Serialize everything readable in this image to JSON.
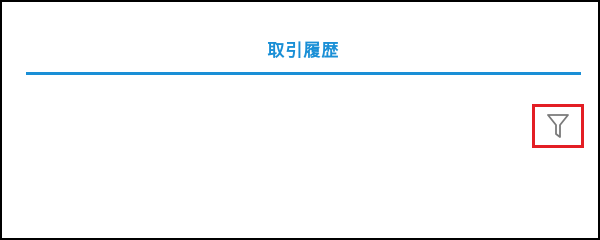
{
  "tab": {
    "active_label": "取引履歴"
  },
  "filter": {
    "icon": "filter-icon"
  },
  "colors": {
    "accent": "#1a8fd6",
    "highlight": "#e31e24",
    "icon": "#7a7a7a",
    "frame_border": "#000000"
  }
}
